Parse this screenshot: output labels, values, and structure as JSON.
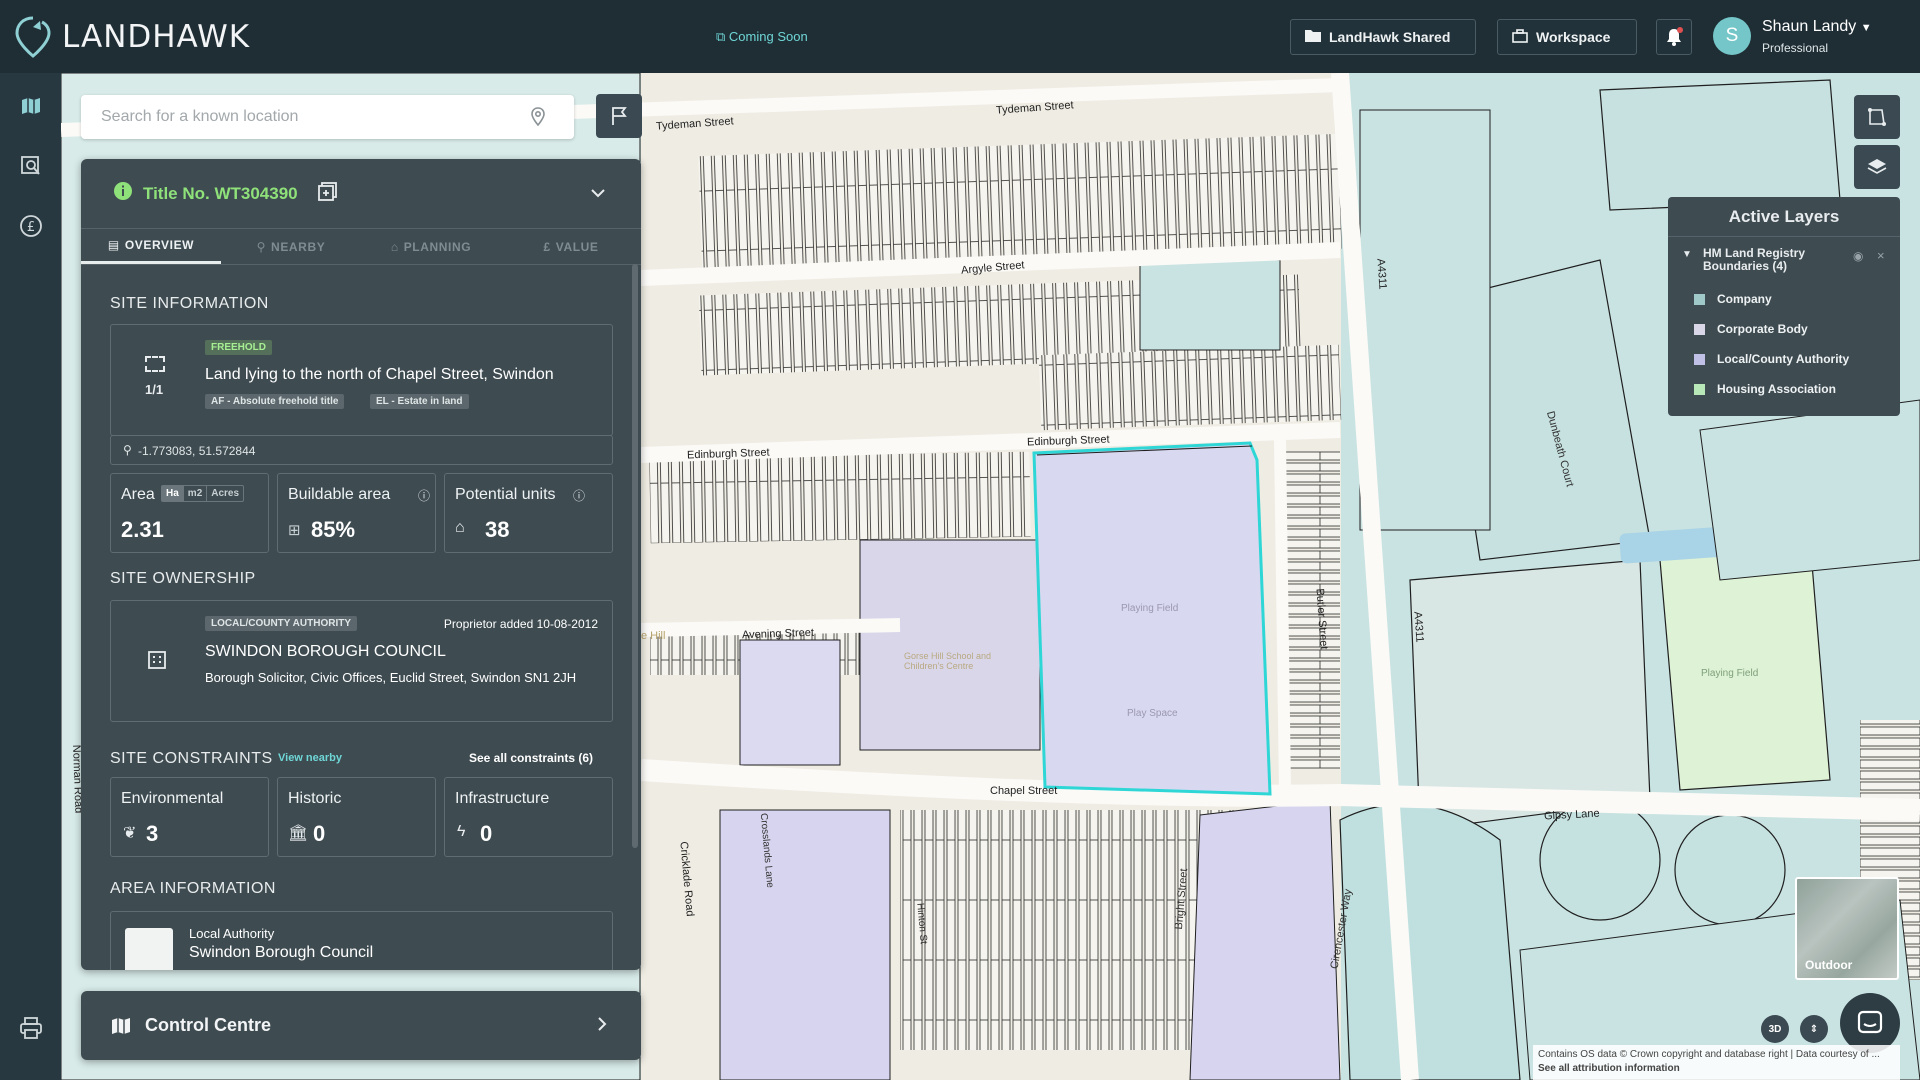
{
  "app": {
    "brand": "LANDHAWK",
    "coming_soon": "Coming Soon"
  },
  "header": {
    "shared_btn": "LandHawk Shared",
    "workspace_btn": "Workspace",
    "user_initial": "S",
    "user_name": "Shaun Landy",
    "user_role": "Professional"
  },
  "search": {
    "placeholder": "Search for a known location"
  },
  "panel": {
    "title": "Title No. WT304390",
    "tabs": [
      "OVERVIEW",
      "NEARBY",
      "PLANNING",
      "VALUE"
    ],
    "site_information": {
      "heading": "SITE INFORMATION",
      "tenure_badge": "FREEHOLD",
      "count": "1/1",
      "description": "Land lying to the north of Chapel Street, Swindon",
      "tag1": "AF - Absolute freehold title",
      "tag2": "EL - Estate in land",
      "coordinates": "-1.773083, 51.572844"
    },
    "stats": {
      "area_label": "Area",
      "unit_ha": "Ha",
      "unit_m2": "m2",
      "unit_acres": "Acres",
      "area_value": "2.31",
      "buildable_label": "Buildable area",
      "buildable_value": "85%",
      "units_label": "Potential units",
      "units_value": "38"
    },
    "ownership": {
      "heading": "SITE OWNERSHIP",
      "badge": "LOCAL/COUNTY AUTHORITY",
      "added": "Proprietor added 10-08-2012",
      "name": "SWINDON BOROUGH COUNCIL",
      "address": "Borough Solicitor, Civic Offices, Euclid Street, Swindon SN1 2JH"
    },
    "constraints": {
      "heading": "SITE CONSTRAINTS",
      "view_nearby": "View nearby",
      "see_all": "See all constraints (6)",
      "env_label": "Environmental",
      "env_value": "3",
      "hist_label": "Historic",
      "hist_value": "0",
      "infra_label": "Infrastructure",
      "infra_value": "0"
    },
    "area_info": {
      "heading": "AREA INFORMATION",
      "authority_label": "Local Authority",
      "authority_value": "Swindon Borough Council"
    }
  },
  "control_centre": "Control Centre",
  "layers": {
    "title": "Active Layers",
    "group": "HM Land Registry Boundaries (4)",
    "items": [
      {
        "label": "Company",
        "color": "#9fc9c9"
      },
      {
        "label": "Corporate Body",
        "color": "#d9d6e8"
      },
      {
        "label": "Local/County Authority",
        "color": "#c0bfe6"
      },
      {
        "label": "Housing Association",
        "color": "#b8e8b8"
      }
    ]
  },
  "map_labels": {
    "tydeman1": "Tydeman Street",
    "tydeman2": "Tydeman Street",
    "argyle": "Argyle Street",
    "edinburgh1": "Edinburgh Street",
    "edinburgh2": "Edinburgh Street",
    "avening": "Avening Street",
    "chapel": "Chapel Street",
    "gipsy": "Gipsy Lane",
    "butler": "Butler Street",
    "a4311a": "A4311",
    "a4311b": "A4311",
    "cricklade": "Cricklade Road",
    "norman": "Norman Road",
    "dunbeath": "Dunbeath Court",
    "bright": "Bright Street",
    "cirencester": "Cirencester Way",
    "playing1": "Playing Field",
    "playing2": "Playing Field",
    "play_space": "Play Space",
    "school": "Gorse Hill School and Children's Centre",
    "hill": "e Hill",
    "hinton": "Hinton St",
    "crossland": "Crosslands Lane"
  },
  "minimap_label": "Outdoor",
  "btn_3d": "3D",
  "attribution": {
    "line1": "Contains OS data © Crown copyright and database right | Data courtesy of ...",
    "line2": "See all attribution information"
  }
}
